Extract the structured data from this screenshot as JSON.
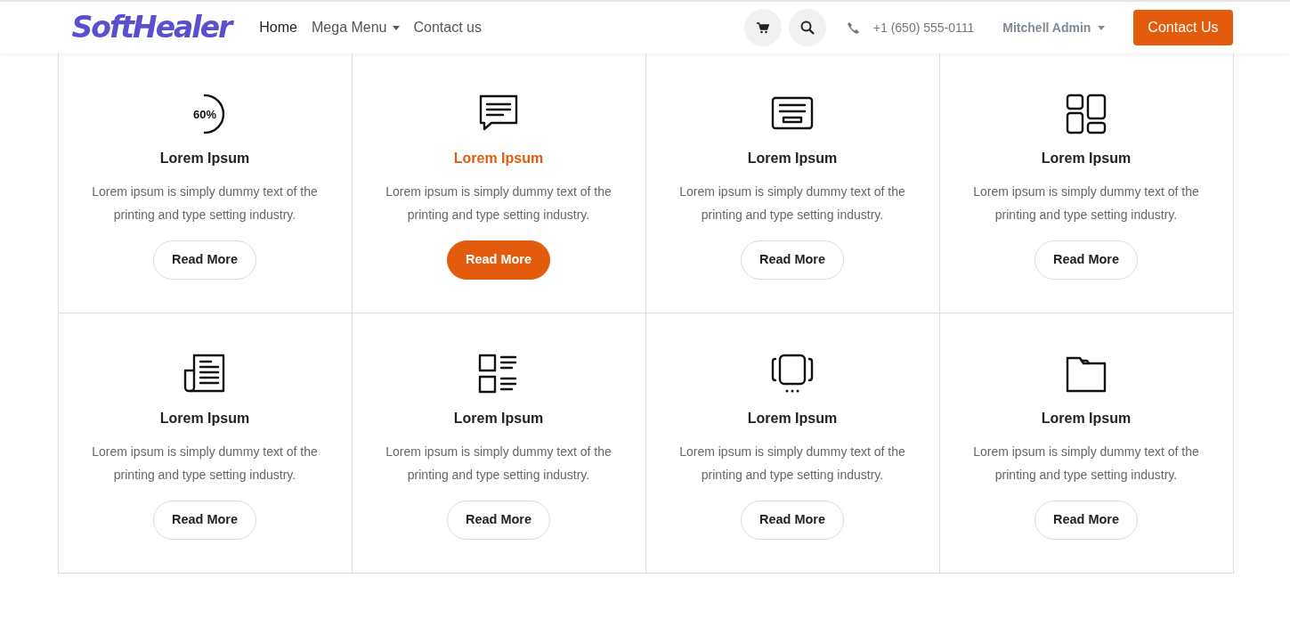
{
  "navbar": {
    "logo": "SoftHealer",
    "menu": [
      {
        "label": "Home",
        "selected": true,
        "dropdown": false
      },
      {
        "label": "Mega Menu",
        "selected": false,
        "dropdown": true
      },
      {
        "label": "Contact us",
        "selected": false,
        "dropdown": false
      }
    ],
    "phone": "+1 (650) 555-0111",
    "user": "Mitchell Admin",
    "cta": "Contact Us"
  },
  "features": [
    {
      "kind": "progress",
      "icon_text": "60%",
      "title": "Lorem Ipsum",
      "text": "Lorem ipsum is simply dummy text of the printing and type setting industry.",
      "button": "Read More",
      "selected": false
    },
    {
      "kind": "chat",
      "title": "Lorem Ipsum",
      "text": "Lorem ipsum is simply dummy text of the printing and type setting industry.",
      "button": "Read More",
      "selected": true
    },
    {
      "kind": "card",
      "title": "Lorem Ipsum",
      "text": "Lorem ipsum is simply dummy text of the printing and type setting industry.",
      "button": "Read More",
      "selected": false
    },
    {
      "kind": "dashboard",
      "title": "Lorem Ipsum",
      "text": "Lorem ipsum is simply dummy text of the printing and type setting industry.",
      "button": "Read More",
      "selected": false
    },
    {
      "kind": "newspaper",
      "title": "Lorem Ipsum",
      "text": "Lorem ipsum is simply dummy text of the printing and type setting industry.",
      "button": "Read More",
      "selected": false
    },
    {
      "kind": "list",
      "title": "Lorem Ipsum",
      "text": "Lorem ipsum is simply dummy text of the printing and type setting industry.",
      "button": "Read More",
      "selected": false
    },
    {
      "kind": "carousel",
      "title": "Lorem Ipsum",
      "text": "Lorem ipsum is simply dummy text of the printing and type setting industry.",
      "button": "Read More",
      "selected": false
    },
    {
      "kind": "folder",
      "title": "Lorem Ipsum",
      "text": "Lorem ipsum is simply dummy text of the printing and type setting industry.",
      "button": "Read More",
      "selected": false
    }
  ]
}
